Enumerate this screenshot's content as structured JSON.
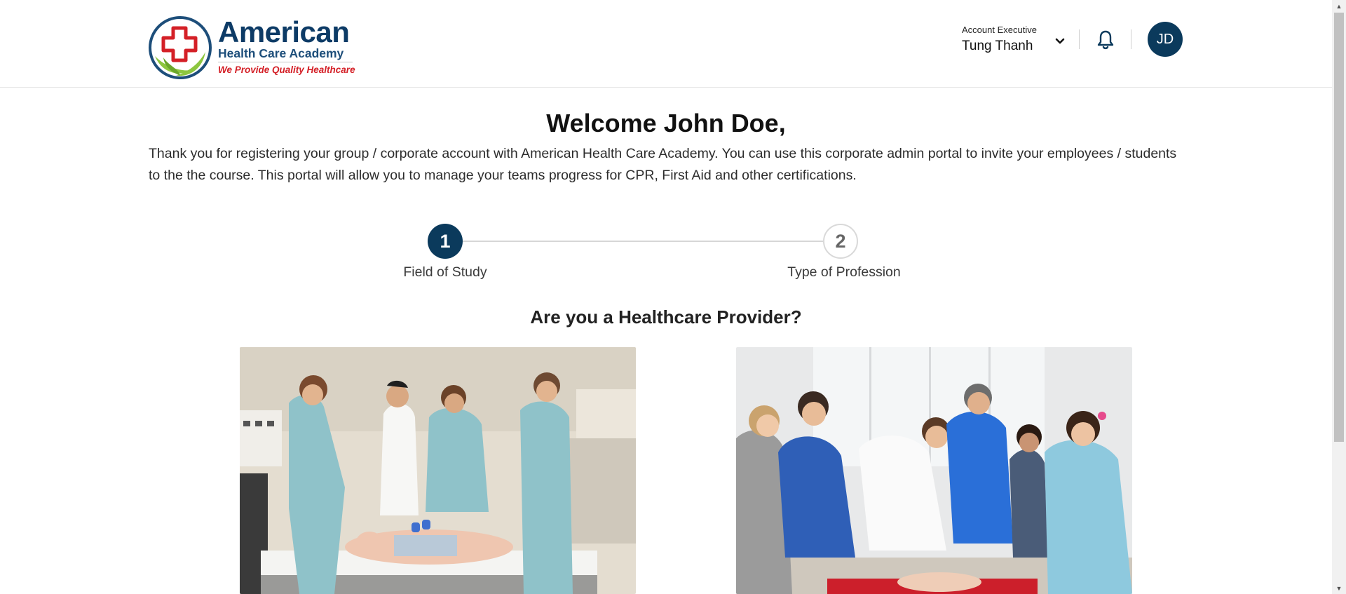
{
  "header": {
    "logo": {
      "title": "American",
      "subtitle": "Health Care Academy",
      "tagline": "We Provide Quality Healthcare"
    },
    "account": {
      "role": "Account Executive",
      "name": "Tung Thanh"
    },
    "avatar_initials": "JD",
    "icons": [
      "chevron-down-icon",
      "bell-icon"
    ]
  },
  "main": {
    "welcome": "Welcome John Doe,",
    "intro": "Thank you for registering your group / corporate account with American Health Care Academy. You can use this corporate admin portal to invite your employees / students to the the course. This portal will allow you to manage your teams progress for CPR, First Aid and other certifications.",
    "steps": [
      {
        "number": "1",
        "label": "Field of Study",
        "active": true
      },
      {
        "number": "2",
        "label": "Type of Profession",
        "active": false
      }
    ],
    "question": "Are you a Healthcare Provider?"
  },
  "colors": {
    "brand_navy": "#0b3a5c",
    "logo_blue": "#0d3b66",
    "tagline_red": "#d42027",
    "logo_green": "#8dc63f"
  }
}
